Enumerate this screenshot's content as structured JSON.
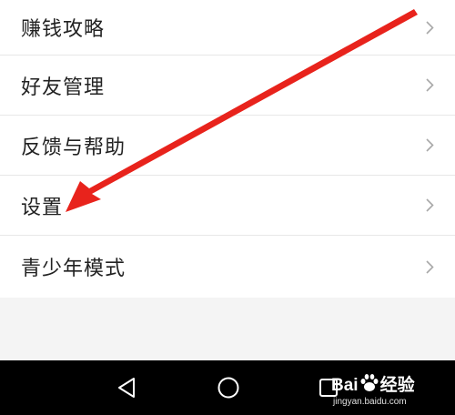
{
  "menu": {
    "items": [
      {
        "label": "赚钱攻略"
      },
      {
        "label": "好友管理"
      },
      {
        "label": "反馈与帮助"
      },
      {
        "label": "设置"
      },
      {
        "label": "青少年模式"
      }
    ]
  },
  "watermark": {
    "brand": "Bai",
    "brand_suffix": "经验",
    "url": "jingyan.baidu.com"
  },
  "colors": {
    "arrow": "#e8231c",
    "chevron": "#a8a8a8",
    "nav_bar": "#000000"
  },
  "icons": {
    "chevron": "chevron-right-icon",
    "nav_back": "triangle-back-icon",
    "nav_home": "circle-home-icon",
    "nav_recent": "square-recent-icon",
    "watermark_paw": "paw-icon"
  }
}
